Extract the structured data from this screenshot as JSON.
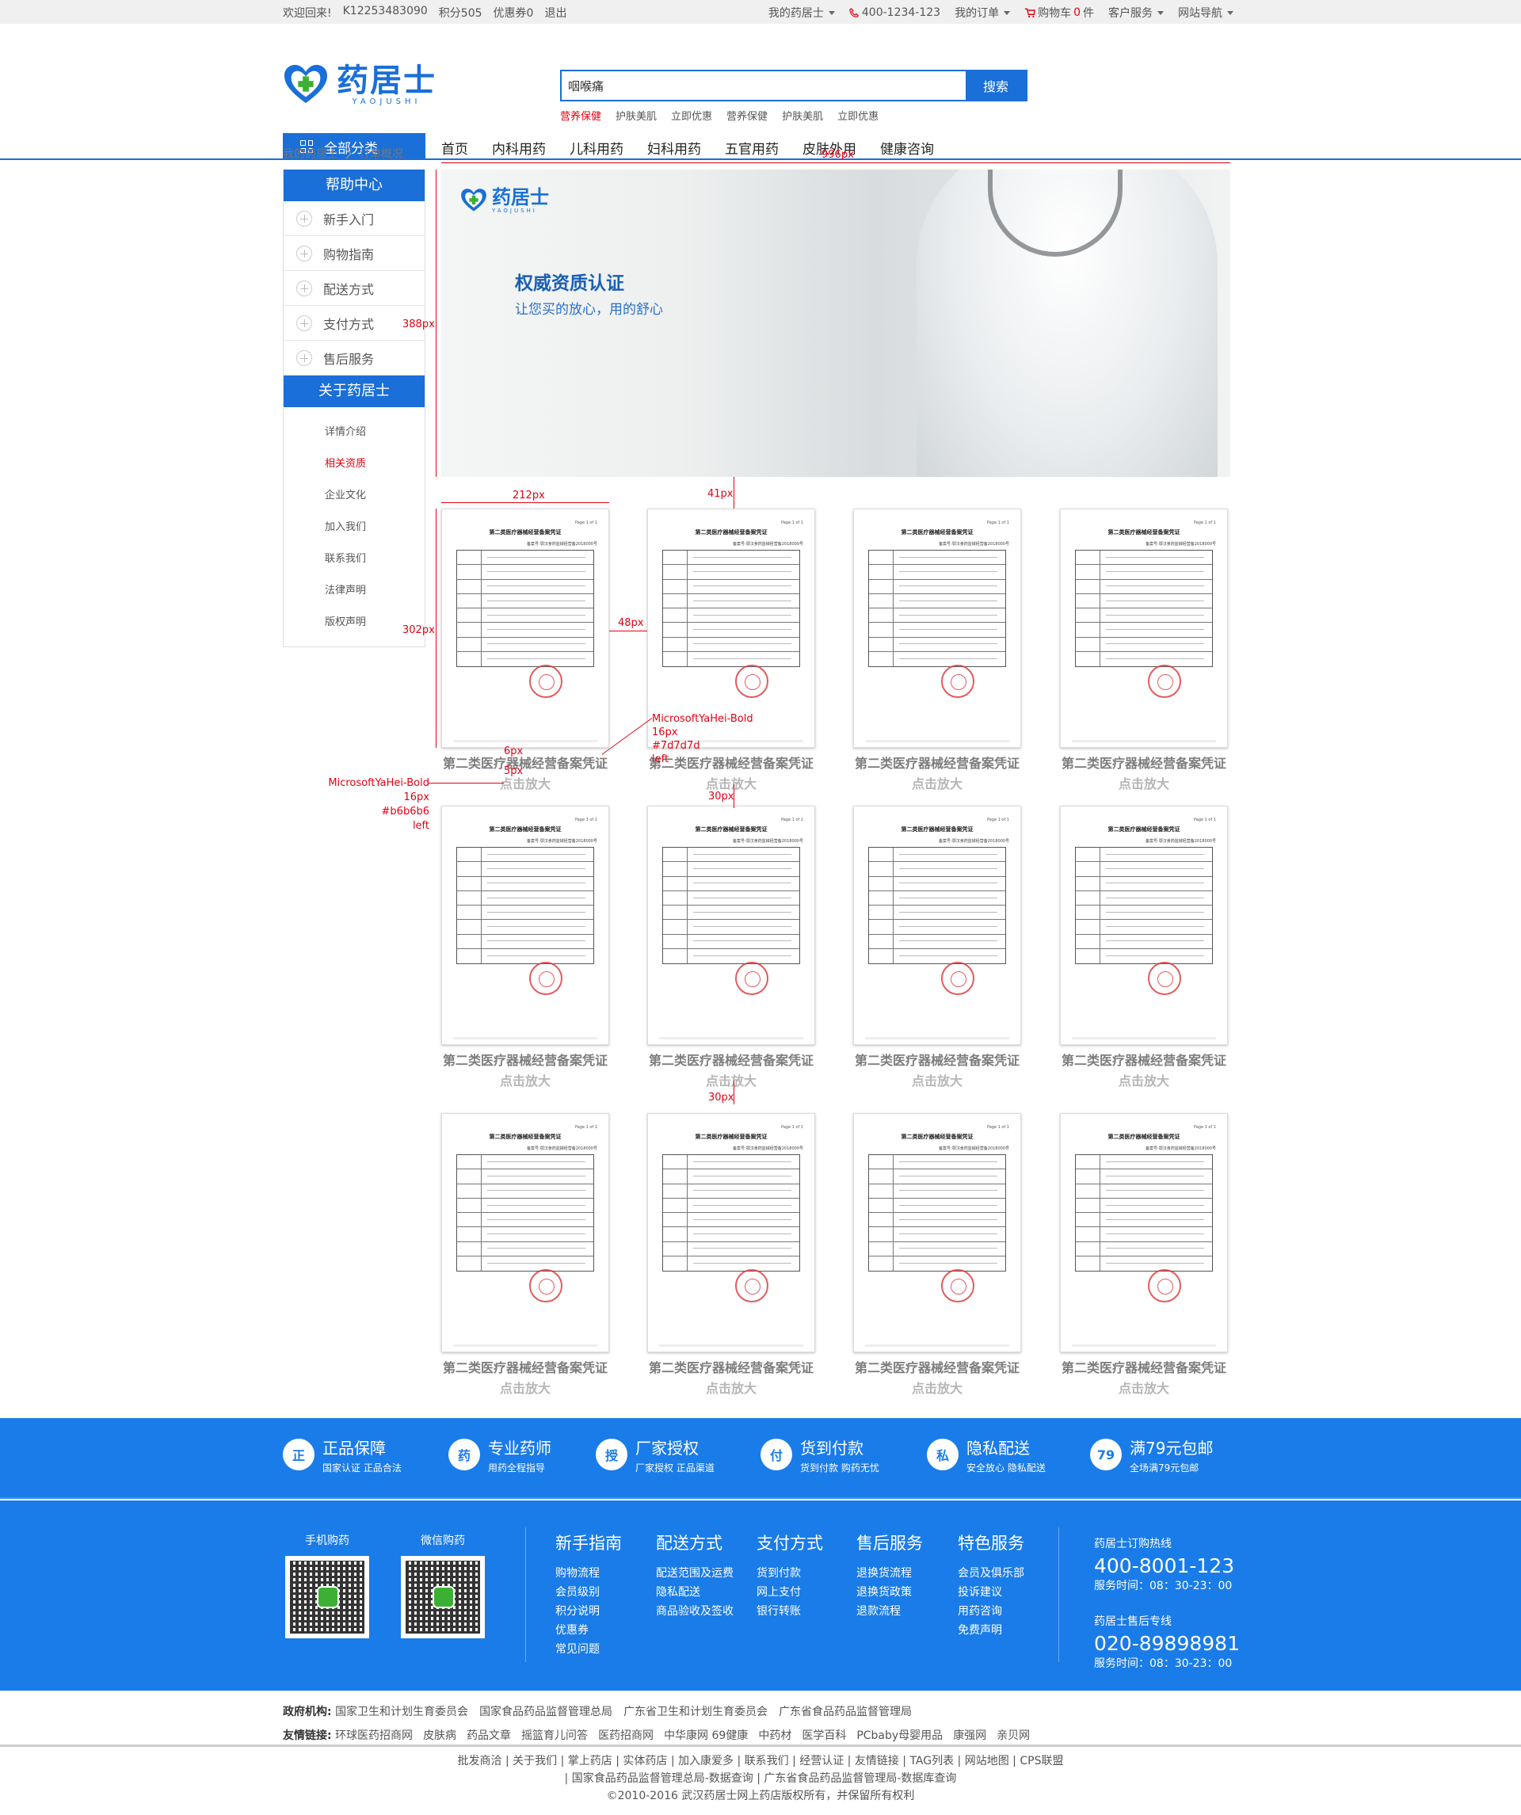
{
  "topbar": {
    "welcome": "欢迎回来!",
    "user": "K12253483090",
    "points": "积分505",
    "coupons": "优惠券0",
    "logout": "退出",
    "my_store": "我的药居士",
    "phone": "400-1234-123",
    "my_orders": "我的订单",
    "cart_prefix": "购物车",
    "cart_count": "0",
    "cart_suffix": "件",
    "service": "客户服务",
    "site_nav": "网站导航"
  },
  "logo": {
    "text": "药居士",
    "sub": "YAOJUSHI"
  },
  "search": {
    "value": "咽喉痛",
    "button": "搜索"
  },
  "hotwords": [
    "营养保健",
    "护肤美肌",
    "立即优惠",
    "营养保健",
    "护肤美肌",
    "立即优惠"
  ],
  "nav": {
    "all": "全部分类",
    "items": [
      "首页",
      "内科用药",
      "儿科用药",
      "妇科用药",
      "五官用药",
      "皮肤外用",
      "健康咨询"
    ]
  },
  "breadcrumb": [
    "我的药居士",
    "订单概况"
  ],
  "sidebar": {
    "help_title": "帮助中心",
    "help_items": [
      "新手入门",
      "购物指南",
      "配送方式",
      "支付方式",
      "售后服务"
    ],
    "about_title": "关于药居士",
    "about_items": [
      "详情介绍",
      "相关资质",
      "企业文化",
      "加入我们",
      "联系我们",
      "法律声明",
      "版权声明"
    ]
  },
  "banner": {
    "title": "权威资质认证",
    "subtitle": "让您买的放心，用的舒心",
    "logo": "药居士",
    "logo_sub": "YAOJUSHI"
  },
  "cert_doc": {
    "title": "第二类医疗器械经营备案凭证",
    "no": "备案号:鄂汉食药监械经营备2018000号",
    "page": "Page 1 of 1"
  },
  "certificates": [
    {
      "name": "第二类医疗器械经营备案凭证",
      "zoom": "点击放大"
    },
    {
      "name": "第二类医疗器械经营备案凭证",
      "zoom": "点击放大"
    },
    {
      "name": "第二类医疗器械经营备案凭证",
      "zoom": "点击放大"
    },
    {
      "name": "第二类医疗器械经营备案凭证",
      "zoom": "点击放大"
    },
    {
      "name": "第二类医疗器械经营备案凭证",
      "zoom": "点击放大"
    },
    {
      "name": "第二类医疗器械经营备案凭证",
      "zoom": "点击放大"
    },
    {
      "name": "第二类医疗器械经营备案凭证",
      "zoom": "点击放大"
    },
    {
      "name": "第二类医疗器械经营备案凭证",
      "zoom": "点击放大"
    },
    {
      "name": "第二类医疗器械经营备案凭证",
      "zoom": "点击放大"
    },
    {
      "name": "第二类医疗器械经营备案凭证",
      "zoom": "点击放大"
    },
    {
      "name": "第二类医疗器械经营备案凭证",
      "zoom": "点击放大"
    },
    {
      "name": "第二类医疗器械经营备案凭证",
      "zoom": "点击放大"
    }
  ],
  "annotations": {
    "w996": "996px",
    "h388": "388px",
    "w212": "212px",
    "h41": "41px",
    "h302": "302px",
    "w48": "48px",
    "h30a": "30px",
    "h30b": "30px",
    "p6": "6px",
    "p5": "5px",
    "font1": "MicrosoftYaHei-Bold",
    "size1": "16px",
    "color1": "#7d7d7d",
    "align1": "left",
    "font2": "MicrosoftYaHei-Bold",
    "size2": "16px",
    "color2": "#b6b6b6",
    "align2": "left"
  },
  "guarantee": [
    {
      "icon": "正",
      "title": "正品保障",
      "sub": "国家认证 正品合法"
    },
    {
      "icon": "药",
      "title": "专业药师",
      "sub": "用药全程指导"
    },
    {
      "icon": "授",
      "title": "厂家授权",
      "sub": "厂家授权 正品渠道"
    },
    {
      "icon": "付",
      "title": "货到付款",
      "sub": "货到付款 购药无忧"
    },
    {
      "icon": "私",
      "title": "隐私配送",
      "sub": "安全放心 隐私配送"
    },
    {
      "icon": "79",
      "title": "满79元包邮",
      "sub": "全场满79元包邮"
    }
  ],
  "footer": {
    "qr1": "手机购药",
    "qr2": "微信购药",
    "cols": [
      {
        "title": "新手指南",
        "items": [
          "购物流程",
          "会员级别",
          "积分说明",
          "优惠券",
          "常见问题"
        ]
      },
      {
        "title": "配送方式",
        "items": [
          "配送范围及运费",
          "隐私配送",
          "商品验收及签收"
        ]
      },
      {
        "title": "支付方式",
        "items": [
          "货到付款",
          "网上支付",
          "银行转账"
        ]
      },
      {
        "title": "售后服务",
        "items": [
          "退换货流程",
          "退换货政策",
          "退款流程"
        ]
      },
      {
        "title": "特色服务",
        "items": [
          "会员及俱乐部",
          "投诉建议",
          "用药咨询",
          "免费声明"
        ]
      }
    ],
    "hotline1_label": "药居士订购热线",
    "hotline1": "400-8001-123",
    "hours1": "服务时间：08：30-23：00",
    "hotline2_label": "药居士售后专线",
    "hotline2": "020-89898981",
    "hours2": "服务时间：08：30-23：00"
  },
  "links": {
    "gov_label": "政府机构:",
    "gov": [
      "国家卫生和计划生育委员会",
      "国家食品药品监督管理总局",
      "广东省卫生和计划生育委员会",
      "广东省食品药品监督管理局"
    ],
    "friend_label": "友情链接:",
    "friends": [
      "环球医药招商网",
      "皮肤病",
      "药品文章",
      "摇篮育儿问答",
      "医药招商网",
      "中华康网 69健康",
      "中药材",
      "医学百科",
      "PCbaby母婴用品",
      "康强网",
      "亲贝网"
    ]
  },
  "copyright": {
    "line1": "批发商洽 | 关于我们 | 掌上药店 | 实体药店 | 加入康爱多 | 联系我们 | 经营认证 | 友情链接 | TAG列表 | 网站地图 | CPS联盟",
    "line2": "| 国家食品药品监督管理总局-数据查询 | 广东省食品药品监督管理局-数据库查询",
    "line3": "©2010-2016 武汉药居士网上药店版权所有，并保留所有权利"
  }
}
